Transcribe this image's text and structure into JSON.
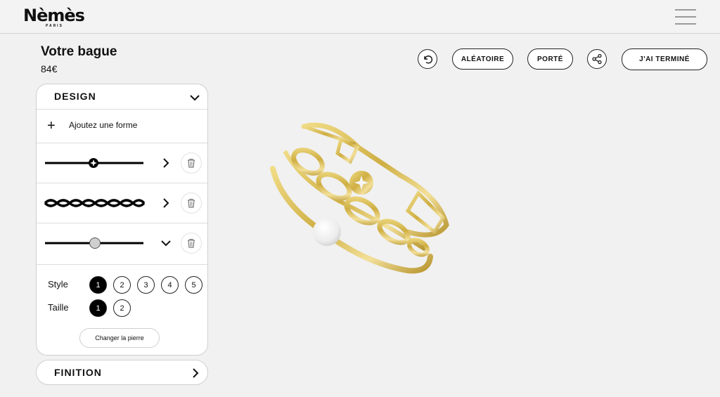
{
  "header": {
    "logo_text": "Nèmès",
    "logo_sub": "PARIS"
  },
  "product": {
    "title": "Votre bague",
    "price": "84€"
  },
  "toolbar": {
    "undo_icon": "undo-icon",
    "random_label": "ALÉATOIRE",
    "worn_label": "PORTÉ",
    "share_icon": "share-icon",
    "finish_label": "J'AI TERMINÉ"
  },
  "design_panel": {
    "title": "DESIGN",
    "add_shape_label": "Ajoutez une forme",
    "shapes": [
      {
        "kind": "line-star",
        "state": "collapsed"
      },
      {
        "kind": "braid",
        "state": "collapsed"
      },
      {
        "kind": "line-bead",
        "state": "expanded"
      }
    ],
    "style_label": "Style",
    "style_options": [
      "1",
      "2",
      "3",
      "4",
      "5"
    ],
    "style_selected": "1",
    "size_label": "Taille",
    "size_options": [
      "1",
      "2"
    ],
    "size_selected": "1",
    "change_stone_label": "Changer la pierre"
  },
  "finish_panel": {
    "title": "FINITION"
  },
  "colors": {
    "gold": "#d9bf5a",
    "accent": "#000000",
    "background": "#f1f1f1"
  }
}
